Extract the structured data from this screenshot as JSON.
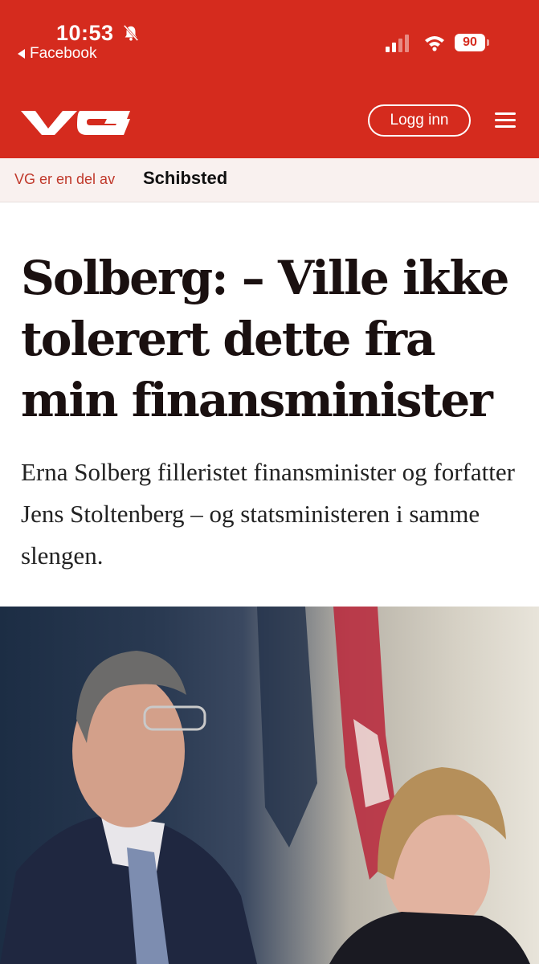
{
  "status_bar": {
    "time": "10:53",
    "back_app": "Facebook",
    "battery": "90"
  },
  "header": {
    "logo": "VG",
    "login_label": "Logg inn"
  },
  "strip": {
    "text": "VG er en del av",
    "brand": "Schibsted"
  },
  "article": {
    "headline": "Solberg: – Ville ikke tolerert dette fra min finansminister",
    "lead": "Erna Solberg filleristet finansminister og forfatter Jens Stoltenberg – og statsministeren i samme slengen."
  },
  "colors": {
    "brand_red": "#d52b1e",
    "strip_bg": "#f9f1ef"
  },
  "icons": [
    "bell-off-icon",
    "cellular-signal-icon",
    "wifi-icon",
    "battery-icon",
    "menu-icon",
    "back-arrow-icon"
  ]
}
